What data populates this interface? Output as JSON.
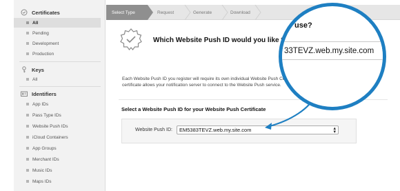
{
  "sidebar": {
    "sections": [
      {
        "name": "Certificates",
        "icon": "certificate-icon",
        "items": [
          {
            "label": "All",
            "active": true
          },
          {
            "label": "Pending"
          },
          {
            "label": "Development"
          },
          {
            "label": "Production"
          }
        ]
      },
      {
        "name": "Keys",
        "icon": "key-icon",
        "items": [
          {
            "label": "All"
          }
        ]
      },
      {
        "name": "Identifiers",
        "icon": "id-card-icon",
        "items": [
          {
            "label": "App IDs"
          },
          {
            "label": "Pass Type IDs"
          },
          {
            "label": "Website Push IDs"
          },
          {
            "label": "iCloud Containers"
          },
          {
            "label": "App Groups"
          },
          {
            "label": "Merchant IDs"
          },
          {
            "label": "Music IDs"
          },
          {
            "label": "Maps IDs"
          }
        ]
      }
    ]
  },
  "steps": [
    "Select Type",
    "Request",
    "Generate",
    "Download"
  ],
  "main": {
    "title": "Which Website Push ID would you like to use?",
    "description_line1": "Each Website Push ID you register will require its own individual Website Push Certi",
    "description_line2": "certificate allows your notification server to connect to the Website Push service.",
    "section_title": "Select a Website Push ID for your Website Push Certificate",
    "field_label": "Website Push ID:",
    "field_value": "EM5383TEVZ.web.my.site.com"
  },
  "magnifier": {
    "title_fragment": "use?",
    "field_value": "33TEVZ.web.my.site.com"
  },
  "colors": {
    "accent": "#1e7fc2",
    "active_step": "#8f8f8f"
  }
}
